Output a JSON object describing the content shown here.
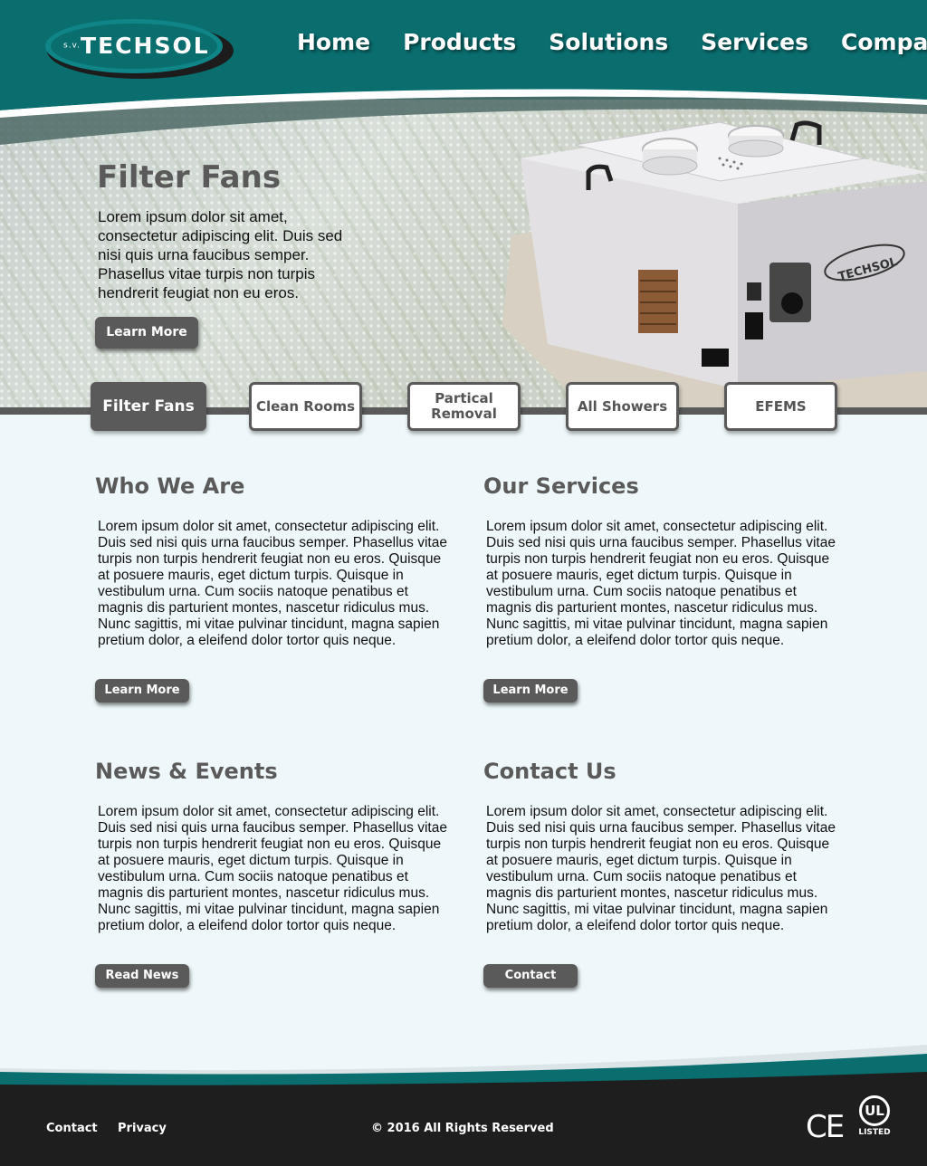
{
  "brand": {
    "prefix": "s.v.",
    "name": "TECHSOL"
  },
  "nav": [
    "Home",
    "Products",
    "Solutions",
    "Services",
    "Company"
  ],
  "hero": {
    "title": "Filter Fans",
    "text": "Lorem ipsum dolor sit amet, consectetur adipiscing elit. Duis sed nisi quis urna faucibus semper. Phasellus vitae turpis non turpis hendrerit feugiat non eu eros.",
    "button": "Learn More",
    "product_label": "TECHSOL"
  },
  "tabs": [
    {
      "label": "Filter Fans",
      "active": true
    },
    {
      "label": "Clean Rooms",
      "active": false
    },
    {
      "label": "Partical Removal",
      "active": false
    },
    {
      "label": "All Showers",
      "active": false
    },
    {
      "label": "EFEMS",
      "active": false
    }
  ],
  "sections": {
    "who": {
      "title": "Who We Are",
      "text": "Lorem ipsum dolor sit amet, consectetur adipiscing elit. Duis sed nisi quis urna faucibus semper. Phasellus vitae turpis non turpis hendrerit feugiat non eu eros. Quisque at posuere mauris, eget dictum turpis. Quisque in vestibulum urna. Cum sociis natoque penatibus et magnis dis parturient montes, nascetur ridiculus mus. Nunc sagittis, mi vitae pulvinar tincidunt, magna sapien pretium dolor, a eleifend dolor tortor quis neque.",
      "button": "Learn More"
    },
    "services": {
      "title": "Our Services",
      "text": "Lorem ipsum dolor sit amet, consectetur adipiscing elit. Duis sed nisi quis urna faucibus semper. Phasellus vitae turpis non turpis hendrerit feugiat non eu eros. Quisque at posuere mauris, eget dictum turpis. Quisque in vestibulum urna. Cum sociis natoque penatibus et magnis dis parturient montes, nascetur ridiculus mus. Nunc sagittis, mi vitae pulvinar tincidunt, magna sapien pretium dolor, a eleifend dolor tortor quis neque.",
      "button": "Learn More"
    },
    "news": {
      "title": "News & Events",
      "text": "Lorem ipsum dolor sit amet, consectetur adipiscing elit. Duis sed nisi quis urna faucibus semper. Phasellus vitae turpis non turpis hendrerit feugiat non eu eros. Quisque at posuere mauris, eget dictum turpis. Quisque in vestibulum urna. Cum sociis natoque penatibus et magnis dis parturient montes, nascetur ridiculus mus. Nunc sagittis, mi vitae pulvinar tincidunt, magna sapien pretium dolor, a eleifend dolor tortor quis neque.",
      "button": "Read News"
    },
    "contact": {
      "title": "Contact Us",
      "text": "Lorem ipsum dolor sit amet, consectetur adipiscing elit. Duis sed nisi quis urna faucibus semper. Phasellus vitae turpis non turpis hendrerit feugiat non eu eros. Quisque at posuere mauris, eget dictum turpis. Quisque in vestibulum urna. Cum sociis natoque penatibus et magnis dis parturient montes, nascetur ridiculus mus. Nunc sagittis, mi vitae pulvinar tincidunt, magna sapien pretium dolor, a eleifend dolor tortor quis neque.",
      "button": "Contact"
    }
  },
  "footer": {
    "links": [
      "Contact",
      "Privacy"
    ],
    "copyright": "© 2016 All Rights Reserved",
    "ce_mark": "CE",
    "ul_mark": "UL",
    "ul_listed": "LISTED"
  },
  "colors": {
    "teal": "#0a6d6e",
    "gray": "#5a5a5a",
    "background": "#eef8fa",
    "footer": "#1e1e1e"
  }
}
